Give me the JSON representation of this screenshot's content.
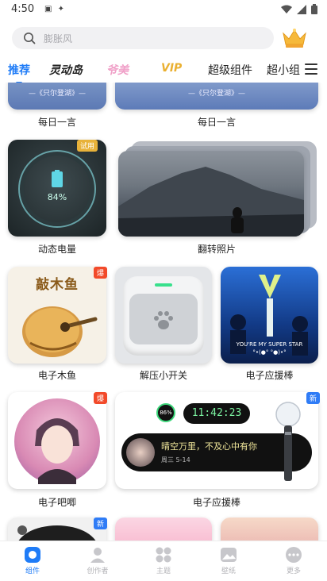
{
  "status_bar": {
    "time": "4:50"
  },
  "search": {
    "placeholder": "膨胀风"
  },
  "tabs": [
    {
      "label": "推荐"
    },
    {
      "label": "灵动岛"
    },
    {
      "label": "爷美"
    },
    {
      "label": "VIP"
    },
    {
      "label": "超级组件"
    },
    {
      "label": "超小组"
    }
  ],
  "widgets": {
    "daily_left": {
      "banner": "—《只尔登湖》—",
      "caption": "每日一言"
    },
    "daily_right": {
      "banner": "—《只尔登湖》—",
      "caption": "每日一言"
    },
    "battery": {
      "badge": "试用",
      "percent": "84%",
      "caption": "动态电量"
    },
    "flip_photo": {
      "caption": "翻转照片"
    },
    "wooden_fish": {
      "badge": "爆",
      "title": "敲木鱼",
      "caption": "电子木鱼"
    },
    "switch": {
      "caption": "解压小开关"
    },
    "light_stick_photo": {
      "overlay": "YOU'RE MY SUPER STAR",
      "overlay2": "°•(●°  °●)•°",
      "caption": "电子应援棒"
    },
    "chat_avatar": {
      "badge": "爆",
      "caption": "电子吧唧"
    },
    "cheer_stick": {
      "badge": "新",
      "battery": "86%",
      "clock": "11:42:23",
      "message": "晴空万里，不及心中有你",
      "date": "周三 5-14",
      "caption": "电子应援棒"
    },
    "row5": {
      "badge": "新"
    }
  },
  "bottom_nav": [
    {
      "label": "组件"
    },
    {
      "label": "创作者"
    },
    {
      "label": "主题"
    },
    {
      "label": "壁纸"
    },
    {
      "label": "更多"
    }
  ],
  "colors": {
    "accent": "#1f7cf7",
    "badge_red": "#f24a2a",
    "badge_blue": "#2f7cf6",
    "badge_gold": "#e8b23a"
  }
}
